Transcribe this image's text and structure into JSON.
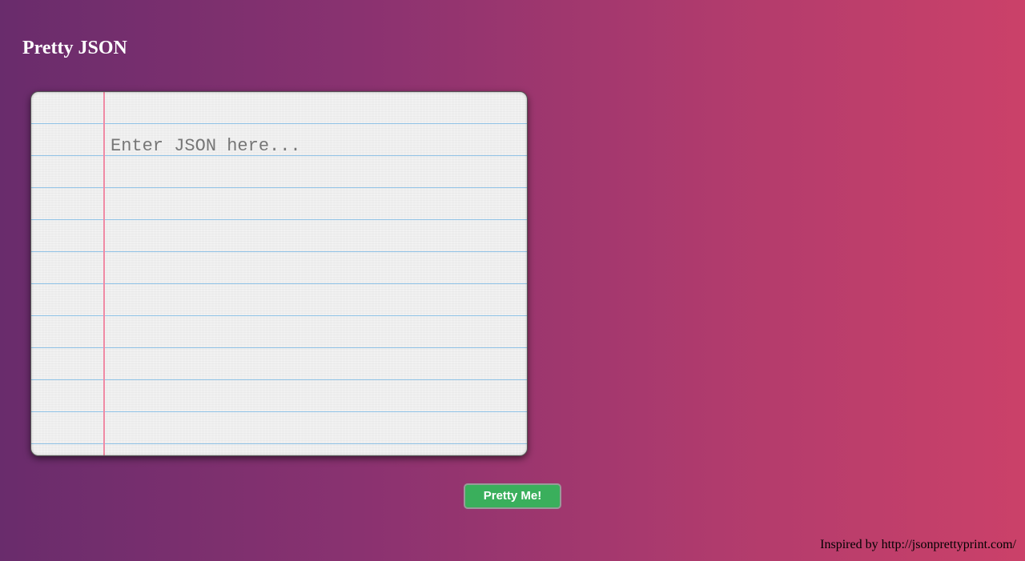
{
  "header": {
    "title": "Pretty JSON"
  },
  "editor": {
    "value": "",
    "placeholder": "Enter JSON here..."
  },
  "actions": {
    "pretty_label": "Pretty Me!"
  },
  "footer": {
    "credit": "Inspired by http://jsonprettyprint.com/"
  },
  "colors": {
    "gradient_start": "#692c6c",
    "gradient_end": "#cb4169",
    "button": "#3aaf5c",
    "margin_line": "#f08aa4",
    "ruled_line": "#8fc2e6"
  }
}
